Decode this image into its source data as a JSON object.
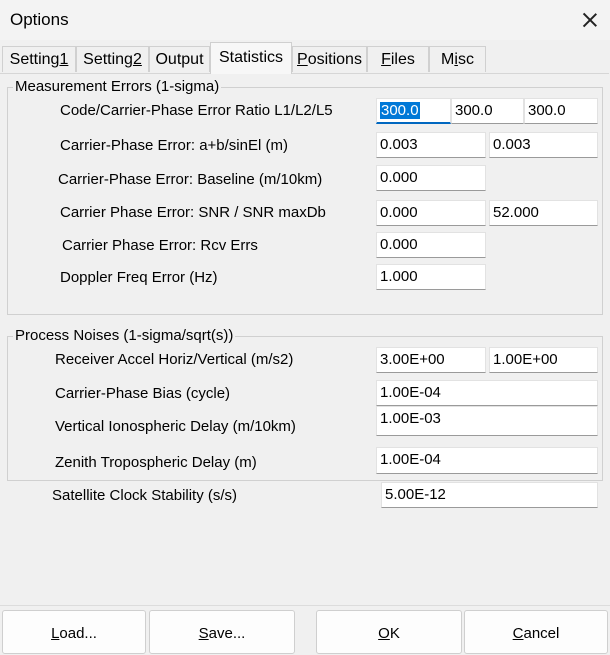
{
  "window": {
    "title": "Options"
  },
  "tabs": [
    {
      "pre": "Setting",
      "u": "1",
      "post": ""
    },
    {
      "pre": "Setting",
      "u": "2",
      "post": ""
    },
    {
      "pre": "Output",
      "u": "",
      "post": ""
    },
    {
      "pre": "Statistics",
      "u": "",
      "post": ""
    },
    {
      "pre": "",
      "u": "P",
      "post": "ositions"
    },
    {
      "pre": "",
      "u": "F",
      "post": "iles"
    },
    {
      "pre": "M",
      "u": "i",
      "post": "sc"
    }
  ],
  "measurement_errors": {
    "title": "Measurement Errors (1-sigma)",
    "code_ratio": {
      "label": "Code/Carrier-Phase Error Ratio L1/L2/L5",
      "l1": "300.0",
      "l2": "300.0",
      "l5": "300.0"
    },
    "phase_error": {
      "label": "Carrier-Phase Error: a+b/sinEl (m)",
      "a": "0.003",
      "b": "0.003"
    },
    "baseline": {
      "label": "Carrier-Phase Error: Baseline (m/10km)",
      "value": "0.000"
    },
    "snr": {
      "label": "Carrier Phase Error: SNR / SNR maxDb",
      "value": "0.000",
      "max": "52.000"
    },
    "rcv": {
      "label": "Carrier Phase Error: Rcv Errs",
      "value": "0.000"
    },
    "doppler": {
      "label": "Doppler Freq Error (Hz)",
      "value": "1.000"
    }
  },
  "process_noises": {
    "title": "Process Noises (1-sigma/sqrt(s))",
    "accel": {
      "label": "Receiver Accel Horiz/Vertical (m/s2)",
      "horiz": "3.00E+00",
      "vert": "1.00E+00"
    },
    "bias": {
      "label": "Carrier-Phase Bias (cycle)",
      "value": "1.00E-04"
    },
    "iono": {
      "label": "Vertical Ionospheric Delay (m/10km)",
      "value": "1.00E-03"
    },
    "tropo": {
      "label": "Zenith Tropospheric Delay (m)",
      "value": "1.00E-04"
    }
  },
  "clock": {
    "label": "Satellite Clock Stability (s/s)",
    "value": "5.00E-12"
  },
  "buttons": {
    "load": {
      "u": "L",
      "rest": "oad..."
    },
    "save": {
      "u": "S",
      "rest": "ave..."
    },
    "ok": {
      "u": "O",
      "rest": "K"
    },
    "cancel": {
      "u": "C",
      "rest": "ancel"
    }
  }
}
